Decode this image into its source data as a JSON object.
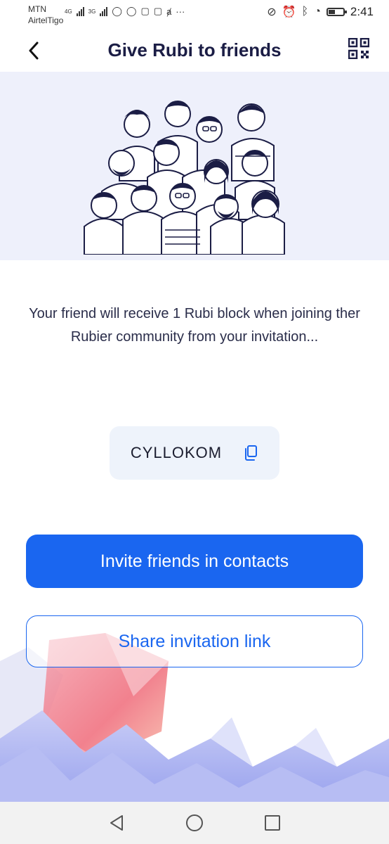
{
  "status_bar": {
    "carrier_1": "MTN",
    "carrier_2": "AirtelTigo",
    "network_1": "4G",
    "network_2": "3G",
    "time": "2:41"
  },
  "header": {
    "title": "Give Rubi to friends",
    "back_icon": "chevron-left-icon",
    "qr_icon": "qr-code-icon"
  },
  "hero": {
    "illustration": "group-of-people-illustration"
  },
  "description": "Your friend will receive 1 Rubi block when joining ther Rubier community from your invitation...",
  "invite_code": {
    "code": "CYLLOKOM",
    "copy_icon": "copy-icon"
  },
  "actions": {
    "invite_contacts_label": "Invite friends in contacts",
    "share_link_label": "Share invitation link"
  },
  "colors": {
    "primary": "#1a66f0",
    "title": "#1b1d45",
    "hero_bg": "#eef0fb",
    "code_bg": "#eef3fb"
  },
  "nav_bar": {
    "back_icon": "triangle-back-icon",
    "home_icon": "circle-home-icon",
    "recents_icon": "square-recents-icon"
  }
}
